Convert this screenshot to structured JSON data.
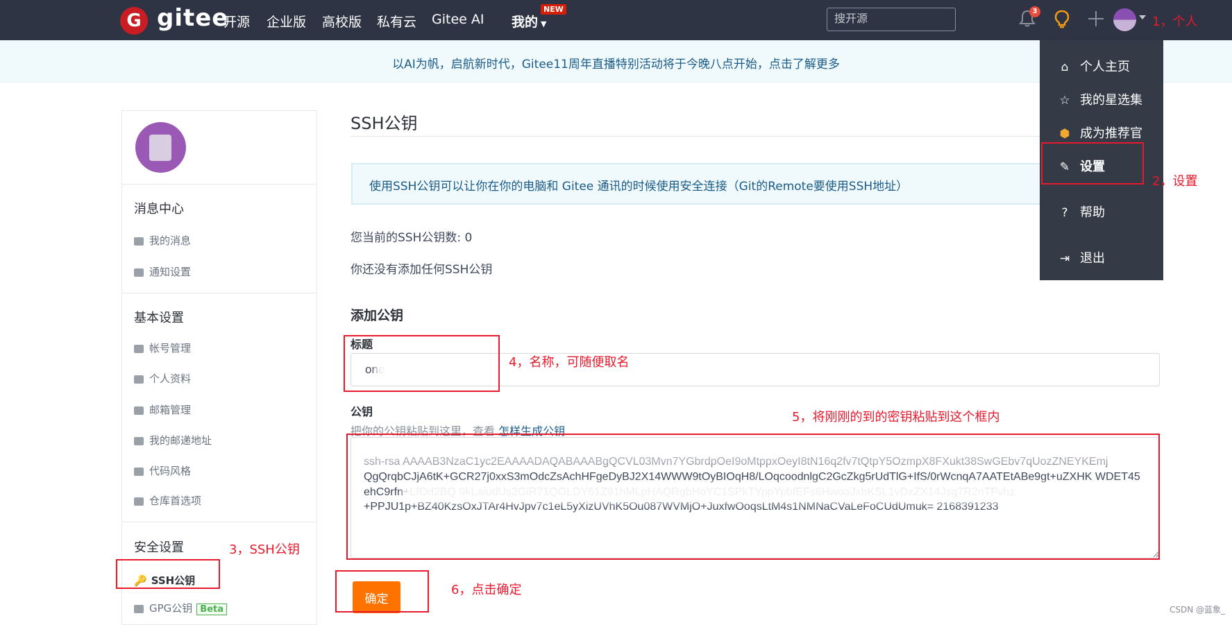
{
  "nav": {
    "logo_badge": "G",
    "logo_text": "gitee",
    "links": [
      "开源",
      "企业版",
      "高校版",
      "私有云",
      "Gitee AI",
      "我的"
    ],
    "new_badge": "NEW",
    "search_placeholder": "搜开源",
    "notification_count": "3"
  },
  "banner": {
    "text": "以AI为帆，启航新时代，Gitee11周年直播特别活动将于今晚八点开始，点击了解更多"
  },
  "sidebar": {
    "message_center": "消息中心",
    "my_messages": "我的消息",
    "notify_settings": "通知设置",
    "basic_settings": "基本设置",
    "account": "帐号管理",
    "profile": "个人资料",
    "email_mgmt": "邮箱管理",
    "mail_address": "我的邮递地址",
    "code_style": "代码风格",
    "repo_prefs": "仓库首选项",
    "security_settings": "安全设置",
    "ssh_keys": "SSH公钥",
    "gpg_keys": "GPG公钥",
    "beta": "Beta"
  },
  "main": {
    "title": "SSH公钥",
    "info": "使用SSH公钥可以让你在你的电脑和 Gitee 通讯的时候使用安全连接（Git的Remote要使用SSH地址）",
    "key_count": "您当前的SSH公钥数: 0",
    "no_keys": "你还没有添加任何SSH公钥",
    "add_key": "添加公钥",
    "title_label": "标题",
    "title_value": "one",
    "key_label": "公钥",
    "key_hint": "把你的公钥粘贴到这里，查看 ",
    "key_hint_link": "怎样生成公钥",
    "key_value": "ssh-rsa AAAAB3NzaC1yc2EAAAADAQABAAABgQCVL03Mvn7YGbrdpOeI9oMtppxOeyI8tN16q2fv7tQtpY5OzmpX8FXukt38SwGEbv7qUozZNEYKEmj QgQrqbCJjA6tK+GCR27j0xxS3mOdcZsAchHFgeDyBJ2X14WWW9tOyBIOqH8/LOqcoodnlgC2GcZkg5rUdTlG+IfS/0rWcnqA7AATEtABe9gt+uZXHK WDET45 ehC9rfn+LfOd2BQ 9kLaiudUs2GiR71QOLDY61Z91hMLpHAQRgbHoYC1SPkTYppYpbfEFs6HwoaJxbKSL1vDxZX14Jsg7R2nTFvhz +PPJU1p+BZ40KzsOxJTAr4HvJpv7c1eL5yXizUVhK5Ou087WVMjO+JuxfwOoqsLtM4s1NMNaCVaLeFoCUdUmuk= 2168391233",
    "confirm_button": "确定"
  },
  "dropdown": {
    "items": [
      {
        "label": "个人主页",
        "icon": "home-icon"
      },
      {
        "label": "我的星选集",
        "icon": "star-icon"
      },
      {
        "label": "成为推荐官",
        "icon": "gitee-badge-icon"
      },
      {
        "label": "设置",
        "icon": "edit-icon"
      },
      {
        "label": "帮助",
        "icon": "help-icon"
      },
      {
        "label": "退出",
        "icon": "logout-icon"
      }
    ]
  },
  "annotations": {
    "a1": "1，个人",
    "a2": "2，设置",
    "a3": "3，SSH公钥",
    "a4": "4，名称，可随便取名",
    "a5": "5，将刚刚的到的密钥粘贴到这个框内",
    "a6": "6，点击确定"
  },
  "watermark": "CSDN @蓝象_",
  "colors": {
    "nav_bg": "#2e3443",
    "brand_red": "#c71d23",
    "confirm_orange": "#fe7300",
    "annotation_red": "#e8192c",
    "info_blue": "#1a5b88"
  }
}
